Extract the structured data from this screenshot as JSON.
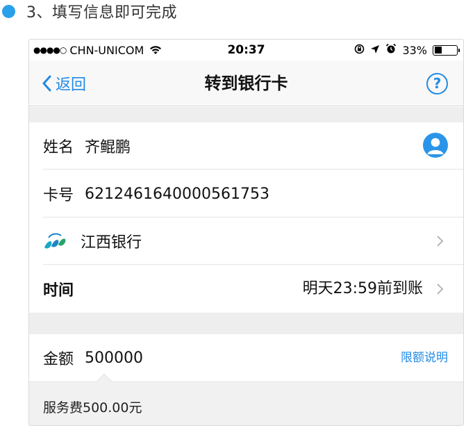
{
  "step": {
    "text": "3、填写信息即可完成"
  },
  "status_bar": {
    "signal": "●●●●○",
    "carrier": "CHN-UNICOM",
    "time": "20:37",
    "battery_percent_text": "33%",
    "battery_level": 0.33
  },
  "nav": {
    "back_label": "返回",
    "title": "转到银行卡",
    "help_label": "?"
  },
  "form": {
    "name_label": "姓名",
    "name_value": "齐鲲鹏",
    "card_label": "卡号",
    "card_value": "6212461640000561753",
    "bank_name": "江西银行",
    "time_label": "时间",
    "time_value": "明天23:59前到账",
    "amount_label": "金额",
    "amount_value": "500000",
    "limit_link": "限额说明",
    "fee_text": "服务费500.00元"
  },
  "colors": {
    "accent": "#1f8ae6",
    "step_dot": "#2aa0ea",
    "section_bg": "#eeeeee"
  },
  "icons": [
    "wifi-icon",
    "lock-rotation-icon",
    "location-arrow-icon",
    "alarm-icon",
    "battery-icon",
    "back-chevron-icon",
    "help-icon",
    "contact-icon",
    "bank-logo",
    "chevron-right-icon"
  ]
}
